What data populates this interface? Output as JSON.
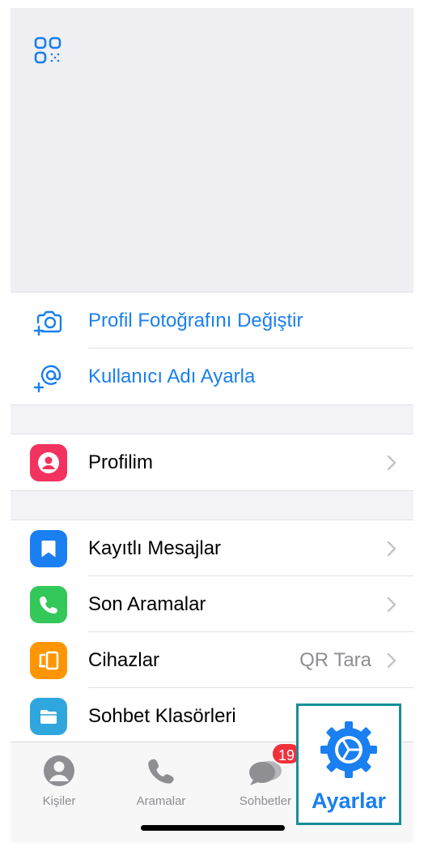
{
  "header": {
    "qr_icon": "qr-code-icon"
  },
  "profile_actions": [
    {
      "label": "Profil Fotoğrafını Değiştir",
      "icon": "camera-add-icon"
    },
    {
      "label": "Kullanıcı Adı Ayarla",
      "icon": "at-sign-add-icon"
    }
  ],
  "profile_section": [
    {
      "label": "Profilim",
      "icon": "person-icon",
      "color": "#f2335f"
    }
  ],
  "main_section": [
    {
      "label": "Kayıtlı Mesajlar",
      "icon": "bookmark-icon",
      "color": "#1a7ff0"
    },
    {
      "label": "Son Aramalar",
      "icon": "phone-icon",
      "color": "#34c759"
    },
    {
      "label": "Cihazlar",
      "icon": "devices-icon",
      "color": "#ff9500",
      "detail": "QR Tara"
    },
    {
      "label": "Sohbet Klasörleri",
      "icon": "folder-icon",
      "color": "#30a6de"
    }
  ],
  "tabbar": {
    "tabs": [
      {
        "label": "Kişiler",
        "icon": "person-circle-icon"
      },
      {
        "label": "Aramalar",
        "icon": "phone-icon"
      },
      {
        "label": "Sohbetler",
        "icon": "chat-bubbles-icon",
        "badge": "19"
      }
    ],
    "settings_tab": {
      "label": "Ayarlar",
      "icon": "gear-icon"
    }
  },
  "colors": {
    "accent": "#1a7ff0",
    "badge": "#f2303b",
    "highlight_border": "#178e98"
  }
}
